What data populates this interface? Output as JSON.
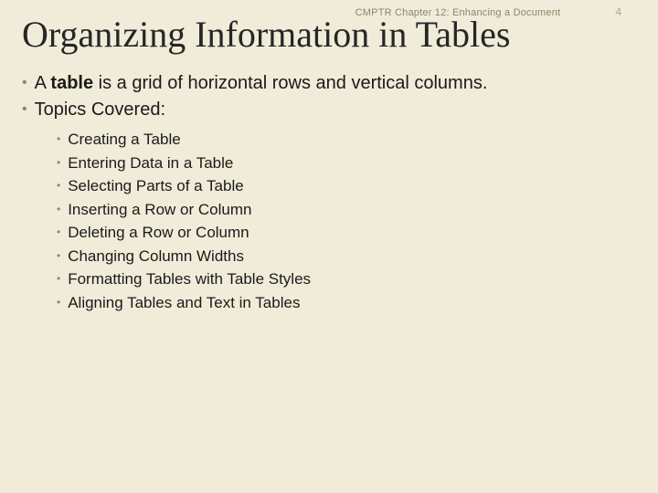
{
  "header": {
    "chapter": "CMPTR Chapter 12: Enhancing a Document",
    "page_number": "4"
  },
  "title": "Organizing Information in Tables",
  "definition": {
    "prefix": "A ",
    "bold": "table",
    "suffix": " is a grid of horizontal rows and vertical columns."
  },
  "topics_label": "Topics Covered:",
  "topics": [
    "Creating a Table",
    "Entering Data in a Table",
    "Selecting Parts of a Table",
    "Inserting a Row or Column",
    "Deleting a Row or Column",
    "Changing Column Widths",
    "Formatting Tables with Table Styles",
    "Aligning Tables and Text in Tables"
  ]
}
